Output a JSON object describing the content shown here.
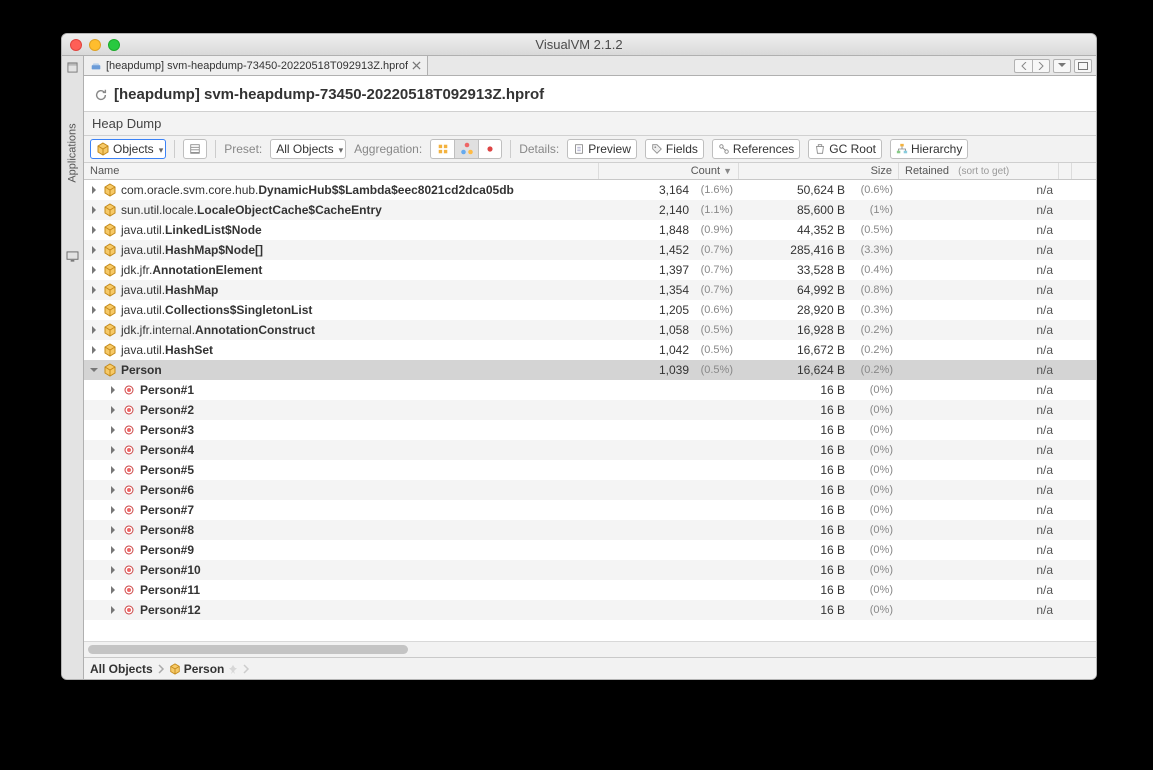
{
  "window": {
    "title": "VisualVM 2.1.2"
  },
  "sidebar": {
    "label": "Applications"
  },
  "tab": {
    "title": "[heapdump] svm-heapdump-73450-20220518T092913Z.hprof"
  },
  "doc": {
    "title_prefix": "[heapdump] ",
    "title_main": "svm-heapdump-73450-20220518T092913Z.hprof",
    "section": "Heap Dump"
  },
  "toolbar": {
    "objects": "Objects",
    "preset_lbl": "Preset:",
    "preset_val": "All Objects",
    "aggregation_lbl": "Aggregation:",
    "details_lbl": "Details:",
    "preview": "Preview",
    "fields": "Fields",
    "references": "References",
    "gcroot": "GC Root",
    "hierarchy": "Hierarchy"
  },
  "columns": {
    "name": "Name",
    "count": "Count",
    "size": "Size",
    "retained": "Retained",
    "retained_hint": "(sort to get)"
  },
  "rows": [
    {
      "kind": "class",
      "indent": 0,
      "expanded": false,
      "pkg": "com.oracle.svm.core.hub.",
      "cls": "DynamicHub$$Lambda$eec8021cd2dca05db",
      "count": "3,164",
      "countPct": "(1.6%)",
      "size": "50,624 B",
      "sizePct": "(0.6%)",
      "retained": "n/a"
    },
    {
      "kind": "class",
      "indent": 0,
      "expanded": false,
      "pkg": "sun.util.locale.",
      "cls": "LocaleObjectCache$CacheEntry",
      "count": "2,140",
      "countPct": "(1.1%)",
      "size": "85,600 B",
      "sizePct": "(1%)",
      "retained": "n/a"
    },
    {
      "kind": "class",
      "indent": 0,
      "expanded": false,
      "pkg": "java.util.",
      "cls": "LinkedList$Node",
      "count": "1,848",
      "countPct": "(0.9%)",
      "size": "44,352 B",
      "sizePct": "(0.5%)",
      "retained": "n/a"
    },
    {
      "kind": "class",
      "indent": 0,
      "expanded": false,
      "pkg": "java.util.",
      "cls": "HashMap$Node[]",
      "count": "1,452",
      "countPct": "(0.7%)",
      "size": "285,416 B",
      "sizePct": "(3.3%)",
      "retained": "n/a"
    },
    {
      "kind": "class",
      "indent": 0,
      "expanded": false,
      "pkg": "jdk.jfr.",
      "cls": "AnnotationElement",
      "count": "1,397",
      "countPct": "(0.7%)",
      "size": "33,528 B",
      "sizePct": "(0.4%)",
      "retained": "n/a"
    },
    {
      "kind": "class",
      "indent": 0,
      "expanded": false,
      "pkg": "java.util.",
      "cls": "HashMap",
      "count": "1,354",
      "countPct": "(0.7%)",
      "size": "64,992 B",
      "sizePct": "(0.8%)",
      "retained": "n/a"
    },
    {
      "kind": "class",
      "indent": 0,
      "expanded": false,
      "pkg": "java.util.",
      "cls": "Collections$SingletonList",
      "count": "1,205",
      "countPct": "(0.6%)",
      "size": "28,920 B",
      "sizePct": "(0.3%)",
      "retained": "n/a"
    },
    {
      "kind": "class",
      "indent": 0,
      "expanded": false,
      "pkg": "jdk.jfr.internal.",
      "cls": "AnnotationConstruct",
      "count": "1,058",
      "countPct": "(0.5%)",
      "size": "16,928 B",
      "sizePct": "(0.2%)",
      "retained": "n/a"
    },
    {
      "kind": "class",
      "indent": 0,
      "expanded": false,
      "pkg": "java.util.",
      "cls": "HashSet",
      "count": "1,042",
      "countPct": "(0.5%)",
      "size": "16,672 B",
      "sizePct": "(0.2%)",
      "retained": "n/a"
    },
    {
      "kind": "class",
      "indent": 0,
      "expanded": true,
      "selected": true,
      "pkg": "",
      "cls": "Person",
      "count": "1,039",
      "countPct": "(0.5%)",
      "size": "16,624 B",
      "sizePct": "(0.2%)",
      "retained": "n/a"
    },
    {
      "kind": "inst",
      "indent": 1,
      "expanded": false,
      "cls": "Person#1",
      "size": "16 B",
      "sizePct": "(0%)",
      "retained": "n/a"
    },
    {
      "kind": "inst",
      "indent": 1,
      "expanded": false,
      "cls": "Person#2",
      "size": "16 B",
      "sizePct": "(0%)",
      "retained": "n/a"
    },
    {
      "kind": "inst",
      "indent": 1,
      "expanded": false,
      "cls": "Person#3",
      "size": "16 B",
      "sizePct": "(0%)",
      "retained": "n/a"
    },
    {
      "kind": "inst",
      "indent": 1,
      "expanded": false,
      "cls": "Person#4",
      "size": "16 B",
      "sizePct": "(0%)",
      "retained": "n/a"
    },
    {
      "kind": "inst",
      "indent": 1,
      "expanded": false,
      "cls": "Person#5",
      "size": "16 B",
      "sizePct": "(0%)",
      "retained": "n/a"
    },
    {
      "kind": "inst",
      "indent": 1,
      "expanded": false,
      "cls": "Person#6",
      "size": "16 B",
      "sizePct": "(0%)",
      "retained": "n/a"
    },
    {
      "kind": "inst",
      "indent": 1,
      "expanded": false,
      "cls": "Person#7",
      "size": "16 B",
      "sizePct": "(0%)",
      "retained": "n/a"
    },
    {
      "kind": "inst",
      "indent": 1,
      "expanded": false,
      "cls": "Person#8",
      "size": "16 B",
      "sizePct": "(0%)",
      "retained": "n/a"
    },
    {
      "kind": "inst",
      "indent": 1,
      "expanded": false,
      "cls": "Person#9",
      "size": "16 B",
      "sizePct": "(0%)",
      "retained": "n/a"
    },
    {
      "kind": "inst",
      "indent": 1,
      "expanded": false,
      "cls": "Person#10",
      "size": "16 B",
      "sizePct": "(0%)",
      "retained": "n/a"
    },
    {
      "kind": "inst",
      "indent": 1,
      "expanded": false,
      "cls": "Person#11",
      "size": "16 B",
      "sizePct": "(0%)",
      "retained": "n/a"
    },
    {
      "kind": "inst",
      "indent": 1,
      "expanded": false,
      "cls": "Person#12",
      "size": "16 B",
      "sizePct": "(0%)",
      "retained": "n/a"
    }
  ],
  "breadcrumb": {
    "root": "All Objects",
    "leaf": "Person"
  }
}
